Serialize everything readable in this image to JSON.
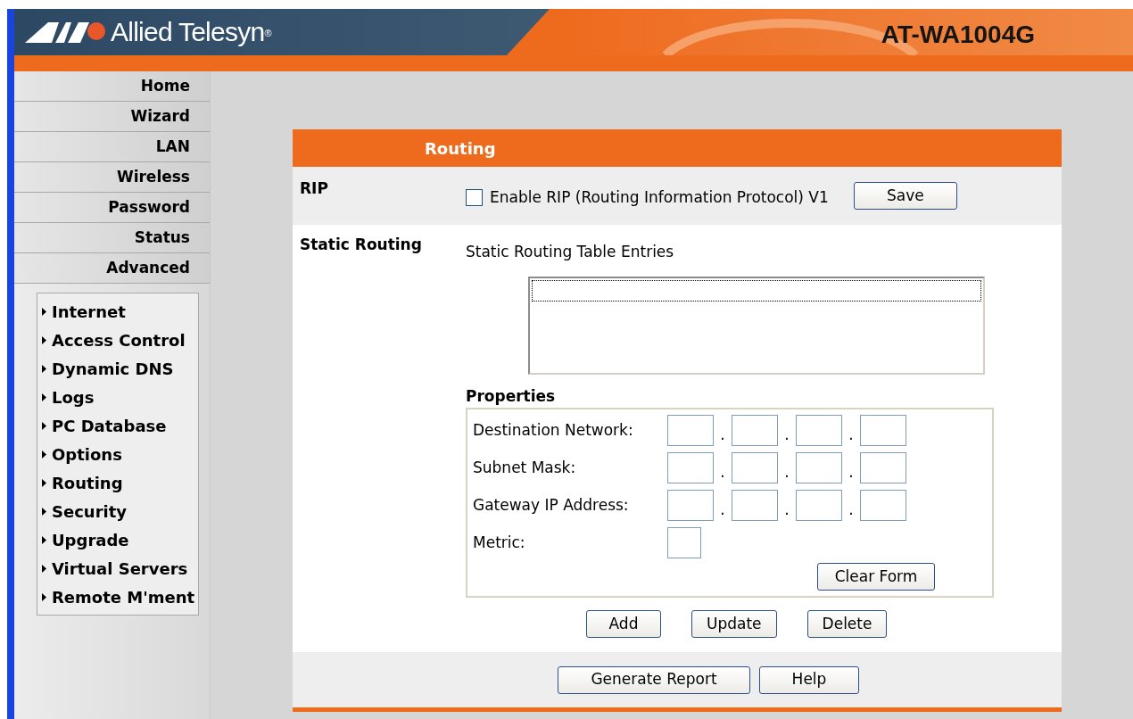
{
  "header": {
    "brand": "Allied Telesyn",
    "registered": "®",
    "model": "AT-WA1004G"
  },
  "main_menu": [
    {
      "label": "Home"
    },
    {
      "label": "Wizard"
    },
    {
      "label": "LAN"
    },
    {
      "label": "Wireless"
    },
    {
      "label": "Password"
    },
    {
      "label": "Status"
    },
    {
      "label": "Advanced"
    }
  ],
  "sub_menu": [
    {
      "label": "Internet"
    },
    {
      "label": "Access Control"
    },
    {
      "label": "Dynamic DNS"
    },
    {
      "label": "Logs"
    },
    {
      "label": "PC Database"
    },
    {
      "label": "Options"
    },
    {
      "label": "Routing"
    },
    {
      "label": "Security"
    },
    {
      "label": "Upgrade"
    },
    {
      "label": "Virtual Servers"
    },
    {
      "label": "Remote M'ment"
    }
  ],
  "panel": {
    "title": "Routing",
    "rip": {
      "label": "RIP",
      "checkbox_label": "Enable RIP (Routing Information Protocol) V1",
      "checked": false,
      "button": "Save"
    },
    "static": {
      "label": "Static Routing",
      "table_label": "Static Routing Table Entries",
      "properties_title": "Properties",
      "separator": ".",
      "fields": [
        {
          "label": "Destination Network:",
          "kind": "ip"
        },
        {
          "label": "Subnet Mask:",
          "kind": "ip"
        },
        {
          "label": "Gateway IP Address:",
          "kind": "ip"
        },
        {
          "label": "Metric:",
          "kind": "single"
        }
      ],
      "clear_button": "Clear Form",
      "actions": [
        "Add",
        "Update",
        "Delete"
      ]
    },
    "footer_buttons": [
      "Generate Report",
      "Help"
    ]
  }
}
